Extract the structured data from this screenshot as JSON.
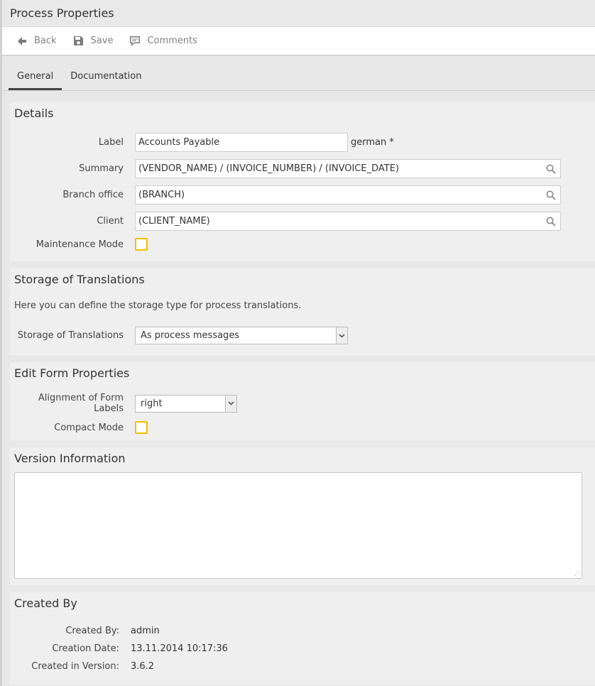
{
  "window": {
    "title": "Process Properties"
  },
  "toolbar": {
    "back_label": "Back",
    "save_label": "Save",
    "comments_label": "Comments"
  },
  "tabs": [
    {
      "label": "General",
      "active": true
    },
    {
      "label": "Documentation",
      "active": false
    }
  ],
  "details": {
    "heading": "Details",
    "label_label": "Label",
    "label_value": "Accounts Payable",
    "label_suffix": "german *",
    "summary_label": "Summary",
    "summary_value": "(VENDOR_NAME) / (INVOICE_NUMBER) / (INVOICE_DATE)",
    "branch_label": "Branch office",
    "branch_value": "(BRANCH)",
    "client_label": "Client",
    "client_value": "(CLIENT_NAME)",
    "maintenance_label": "Maintenance Mode",
    "maintenance_checked": false
  },
  "translations": {
    "heading": "Storage of Translations",
    "description": "Here you can define the storage type for process translations.",
    "storage_label": "Storage of Translations",
    "storage_value": "As process messages"
  },
  "form_props": {
    "heading": "Edit Form Properties",
    "alignment_label": "Alignment of Form Labels",
    "alignment_value": "right",
    "compact_label": "Compact Mode",
    "compact_checked": false
  },
  "version": {
    "heading": "Version Information",
    "text": ""
  },
  "created": {
    "heading": "Created By",
    "by_label": "Created By:",
    "by_value": "admin",
    "date_label": "Creation Date:",
    "date_value": "13.11.2014 10:17:36",
    "version_label": "Created in Version:",
    "version_value": "3.6.2"
  },
  "colors": {
    "checkbox_border": "#f3c000",
    "active_tab": "#444444"
  }
}
